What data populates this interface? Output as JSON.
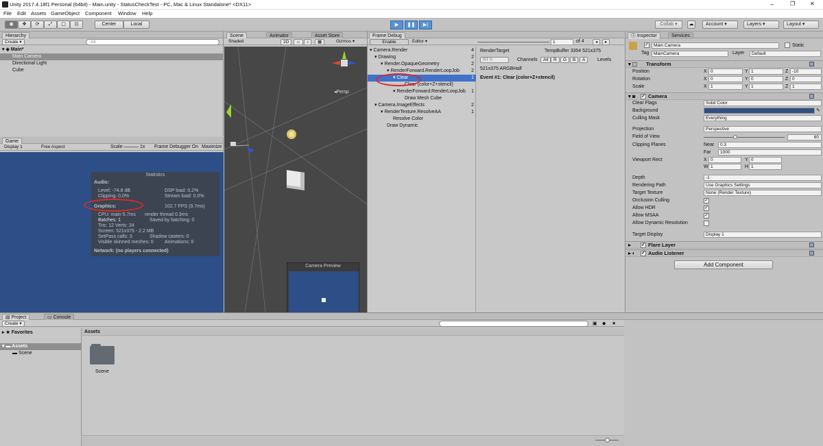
{
  "window": {
    "title": "Unity 2017.4.18f1 Personal (64bit) - Main.unity - StatusCheckTest - PC, Mac & Linux Standalone* <DX11>",
    "min": "–",
    "max": "❐",
    "close": "✕"
  },
  "menu": [
    "File",
    "Edit",
    "Assets",
    "GameObject",
    "Component",
    "Window",
    "Help"
  ],
  "toolbar": {
    "center": "Center",
    "local": "Local",
    "collab": "Collab ▾",
    "account": "Account",
    "layers": "Layers",
    "layout": "Layout"
  },
  "hierarchy": {
    "tab": "Hierarchy",
    "create": "Create ▾",
    "search": "All",
    "scene": "Main*",
    "items": [
      "Main Camera",
      "Directional Light",
      "Cube"
    ]
  },
  "game": {
    "tab": "Game",
    "display": "Display 1",
    "aspect": "Free Aspect",
    "scale_label": "Scale",
    "scale_value": "1x",
    "fd_on": "Frame Debugger On",
    "maximize": "Maximize",
    "stats": {
      "title": "Statistics",
      "audio": "Audio:",
      "level": "Level: -74.8 dB",
      "dsp": "DSP load: 0.2%",
      "clipping": "Clipping: 0.0%",
      "stream": "Stream load: 0.0%",
      "graphics": "Graphics:",
      "fps": "102.7 FPS (9.7ms)",
      "cpu": "CPU: main 5.7ms",
      "render_thread": "render thread 0.3ms",
      "batches": "Batches: 1",
      "saved": "Saved by batching: 0",
      "tris": "Tris: 12  Verts: 24",
      "screen": "Screen: 521x375 - 2.2 MB",
      "setpass": "SetPass calls: 3",
      "shadow": "Shadow casters: 0",
      "skinned": "Visible skinned meshes: 0",
      "animations": "Animations: 0",
      "network": "Network: (no players connected)"
    }
  },
  "scene": {
    "tab": "Scene",
    "animator_tab": "Animator",
    "asset_store_tab": "Asset Store",
    "shaded": "Shaded",
    "mode2d": "2D",
    "gizmos": "Gizmos ▾",
    "persp": "◂Persp",
    "preview": "Camera Preview"
  },
  "frame_debug": {
    "tab": "Frame Debug",
    "enable": "Enable",
    "editor": "Editor ▾",
    "current": "1",
    "of": "of 4",
    "tree": [
      {
        "label": "Camera.Render",
        "count": "4"
      },
      {
        "label": "Drawing",
        "count": "2"
      },
      {
        "label": "Render.OpaqueGeometry",
        "count": "2"
      },
      {
        "label": "RenderForward.RenderLoopJob",
        "count": "2"
      },
      {
        "label": "Clear",
        "count": "1"
      },
      {
        "label": "Clear (color+Z+stencil)",
        "count": ""
      },
      {
        "label": "RenderForward.RenderLoopJob",
        "count": "1"
      },
      {
        "label": "Draw Mesh Cube",
        "count": ""
      },
      {
        "label": "Camera.ImageEffects",
        "count": "2"
      },
      {
        "label": "RenderTexture.ResolveAA",
        "count": "1"
      },
      {
        "label": "Resolve Color",
        "count": ""
      },
      {
        "label": "Draw Dynamic",
        "count": ""
      }
    ],
    "rt_label": "RenderTarget",
    "rt_value": "TempBuffer 3354 521x375",
    "rt0": "RT 0",
    "channels": "Channels",
    "ch": [
      "All",
      "R",
      "G",
      "B",
      "A"
    ],
    "levels": "Levels",
    "format": "521x375 ARGBHalf",
    "event": "Event #1: Clear (color+Z+stencil)"
  },
  "inspector": {
    "tab": "Inspector",
    "services_tab": "Services",
    "name": "Main Camera",
    "static": "Static",
    "tag_label": "Tag",
    "tag": "MainCamera",
    "layer_label": "Layer",
    "layer": "Default",
    "transform": {
      "title": "Transform",
      "position": "Position",
      "rotation": "Rotation",
      "scale": "Scale",
      "px": "0",
      "py": "1",
      "pz": "-10",
      "rx": "0",
      "ry": "0",
      "rz": "0",
      "sx": "1",
      "sy": "1",
      "sz": "1"
    },
    "camera": {
      "title": "Camera",
      "clear_flags": "Clear Flags",
      "clear_flags_val": "Solid Color",
      "background": "Background",
      "culling": "Culling Mask",
      "culling_val": "Everything",
      "projection": "Projection",
      "projection_val": "Perspective",
      "fov": "Field of View",
      "fov_val": "60",
      "clipping": "Clipping Planes",
      "near": "Near",
      "near_val": "0.3",
      "far": "Far",
      "far_val": "1000",
      "viewport": "Viewport Rect",
      "vx": "0",
      "vy": "0",
      "vw": "1",
      "vh": "1",
      "depth": "Depth",
      "depth_val": "-1",
      "rpath": "Rendering Path",
      "rpath_val": "Use Graphics Settings",
      "target_tex": "Target Texture",
      "target_tex_val": "None (Render Texture)",
      "occlusion": "Occlusion Culling",
      "hdr": "Allow HDR",
      "msaa": "Allow MSAA",
      "dynres": "Allow Dynamic Resolution",
      "tdisplay": "Target Display",
      "tdisplay_val": "Display 1"
    },
    "flare": "Flare Layer",
    "audio": "Audio Listener",
    "add": "Add Component"
  },
  "project": {
    "tab": "Project",
    "console_tab": "Console",
    "create": "Create ▾",
    "favorites": "Favorites",
    "assets": "Assets",
    "scene_folder": "Scene",
    "crumb": "Assets",
    "folder_label": "Scene"
  },
  "colors": {
    "game_bg": "#2d4e86",
    "selection": "#3f72c8",
    "annotation": "#d92a2a"
  }
}
